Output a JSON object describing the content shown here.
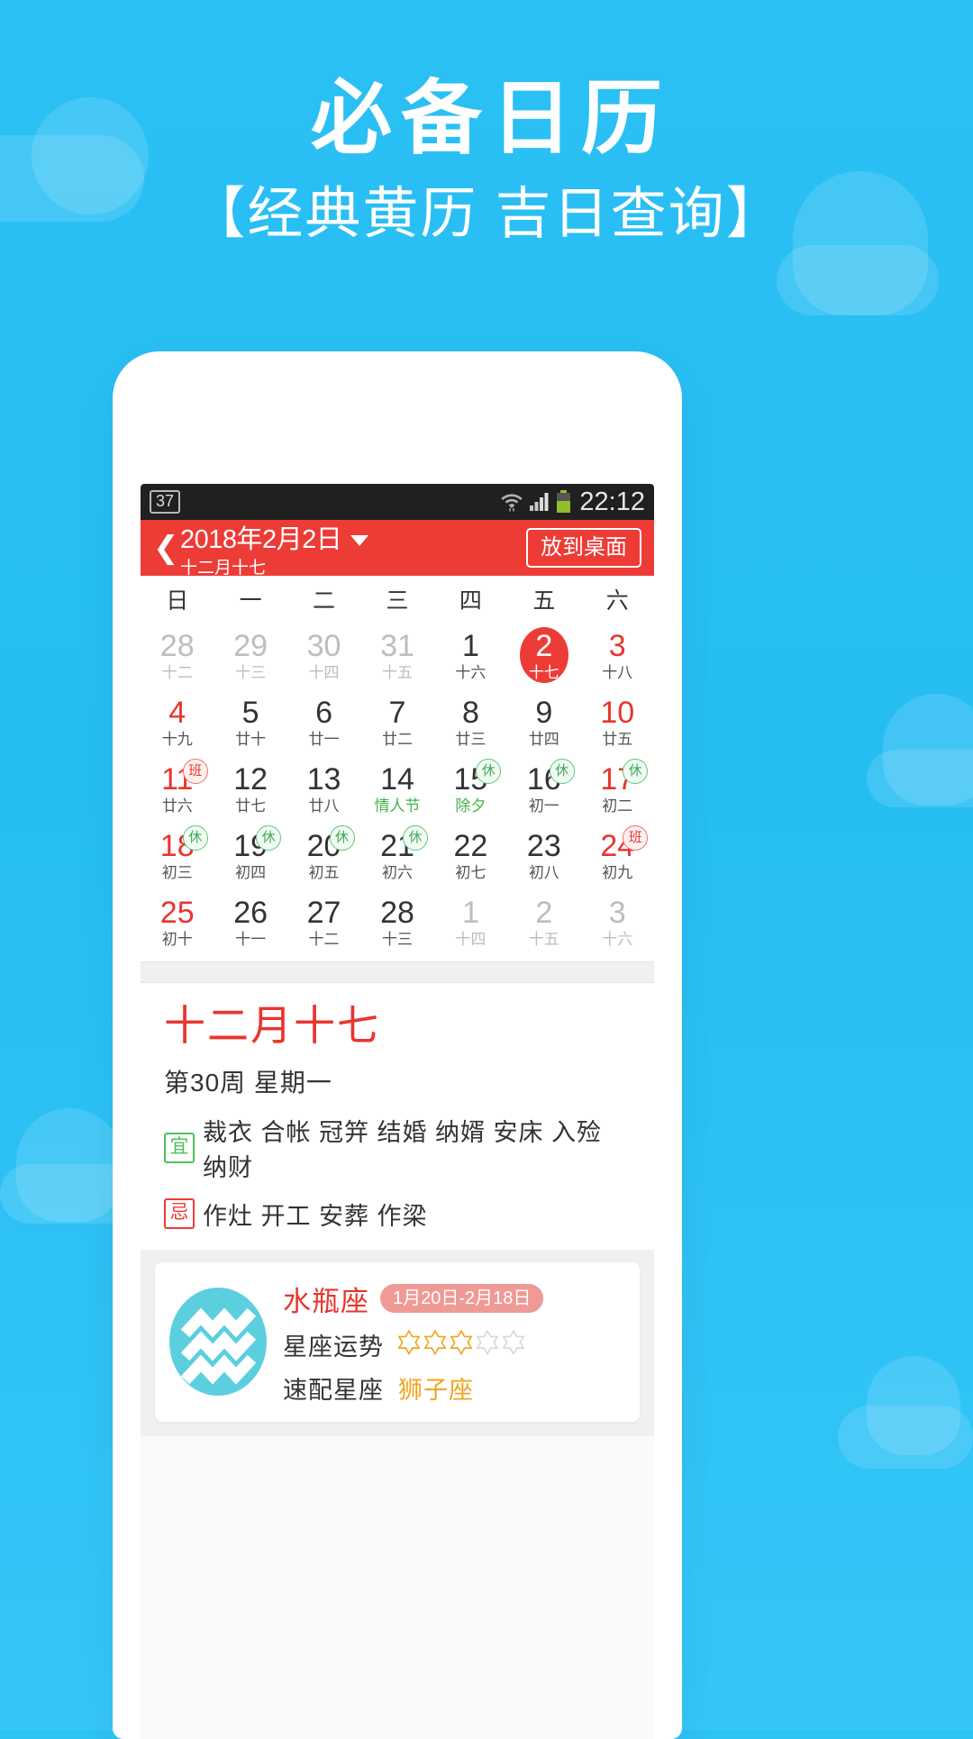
{
  "hero": {
    "title": "必备日历",
    "subtitle": "【经典黄历 吉日查询】"
  },
  "colors": {
    "background": "#2bc0f4",
    "accent_red": "#ed3b36",
    "rest_green": "#4cc258",
    "star_gold": "#f0a51e",
    "zodiac_teal": "#5ccfdf"
  },
  "statusbar": {
    "notification_badge": "37",
    "wifi_icon": "wifi-icon",
    "signal_icon": "cellular-signal-icon",
    "battery_icon": "battery-icon",
    "time": "22:12"
  },
  "appbar": {
    "back_icon": "back-chevron-icon",
    "date": "2018年2月2日",
    "dropdown_icon": "chevron-down-icon",
    "lunar": "十二月十七",
    "desktop_button": "放到桌面"
  },
  "calendar": {
    "weekdays": [
      "日",
      "一",
      "二",
      "三",
      "四",
      "五",
      "六"
    ],
    "rows": [
      [
        {
          "num": "28",
          "lunar": "十二",
          "tone": "muted"
        },
        {
          "num": "29",
          "lunar": "十三",
          "tone": "muted"
        },
        {
          "num": "30",
          "lunar": "十四",
          "tone": "muted"
        },
        {
          "num": "31",
          "lunar": "十五",
          "tone": "muted"
        },
        {
          "num": "1",
          "lunar": "十六",
          "tone": "normal"
        },
        {
          "num": "2",
          "lunar": "十七",
          "tone": "normal",
          "selected": true
        },
        {
          "num": "3",
          "lunar": "十八",
          "tone": "red"
        }
      ],
      [
        {
          "num": "4",
          "lunar": "十九",
          "tone": "red"
        },
        {
          "num": "5",
          "lunar": "廿十",
          "tone": "normal"
        },
        {
          "num": "6",
          "lunar": "廿一",
          "tone": "normal"
        },
        {
          "num": "7",
          "lunar": "廿二",
          "tone": "normal"
        },
        {
          "num": "8",
          "lunar": "廿三",
          "tone": "normal"
        },
        {
          "num": "9",
          "lunar": "廿四",
          "tone": "normal"
        },
        {
          "num": "10",
          "lunar": "廿五",
          "tone": "red"
        }
      ],
      [
        {
          "num": "11",
          "lunar": "廿六",
          "tone": "red",
          "badge": "班",
          "badge_type": "work"
        },
        {
          "num": "12",
          "lunar": "廿七",
          "tone": "normal"
        },
        {
          "num": "13",
          "lunar": "廿八",
          "tone": "normal"
        },
        {
          "num": "14",
          "lunar": "情人节",
          "tone": "normal",
          "lunar_green": true
        },
        {
          "num": "15",
          "lunar": "除夕",
          "tone": "normal",
          "lunar_green": true,
          "badge": "休",
          "badge_type": "rest"
        },
        {
          "num": "16",
          "lunar": "初一",
          "tone": "normal",
          "badge": "休",
          "badge_type": "rest"
        },
        {
          "num": "17",
          "lunar": "初二",
          "tone": "red",
          "badge": "休",
          "badge_type": "rest"
        }
      ],
      [
        {
          "num": "18",
          "lunar": "初三",
          "tone": "red",
          "badge": "休",
          "badge_type": "rest"
        },
        {
          "num": "19",
          "lunar": "初四",
          "tone": "normal",
          "badge": "休",
          "badge_type": "rest"
        },
        {
          "num": "20",
          "lunar": "初五",
          "tone": "normal",
          "badge": "休",
          "badge_type": "rest"
        },
        {
          "num": "21",
          "lunar": "初六",
          "tone": "normal",
          "badge": "休",
          "badge_type": "rest"
        },
        {
          "num": "22",
          "lunar": "初七",
          "tone": "normal"
        },
        {
          "num": "23",
          "lunar": "初八",
          "tone": "normal"
        },
        {
          "num": "24",
          "lunar": "初九",
          "tone": "red",
          "badge": "班",
          "badge_type": "work"
        }
      ],
      [
        {
          "num": "25",
          "lunar": "初十",
          "tone": "red"
        },
        {
          "num": "26",
          "lunar": "十一",
          "tone": "normal"
        },
        {
          "num": "27",
          "lunar": "十二",
          "tone": "normal"
        },
        {
          "num": "28",
          "lunar": "十三",
          "tone": "normal"
        },
        {
          "num": "1",
          "lunar": "十四",
          "tone": "muted"
        },
        {
          "num": "2",
          "lunar": "十五",
          "tone": "muted"
        },
        {
          "num": "3",
          "lunar": "十六",
          "tone": "muted"
        }
      ]
    ]
  },
  "detail": {
    "lunar_big": "十二月十七",
    "week_line": "第30周 星期一",
    "yi_mark": "宜",
    "yi_items": "裁衣 合帐 冠笄 结婚 纳婿 安床 入殓 纳财",
    "ji_mark": "忌",
    "ji_items": "作灶 开工 安葬 作梁"
  },
  "zodiac": {
    "avatar_icon": "aquarius-icon",
    "name": "水瓶座",
    "range": "1月20日-2月18日",
    "fortune_label": "星座运势",
    "fortune_stars_filled": 3,
    "fortune_stars_total": 5,
    "match_label": "速配星座",
    "match_value": "狮子座"
  }
}
